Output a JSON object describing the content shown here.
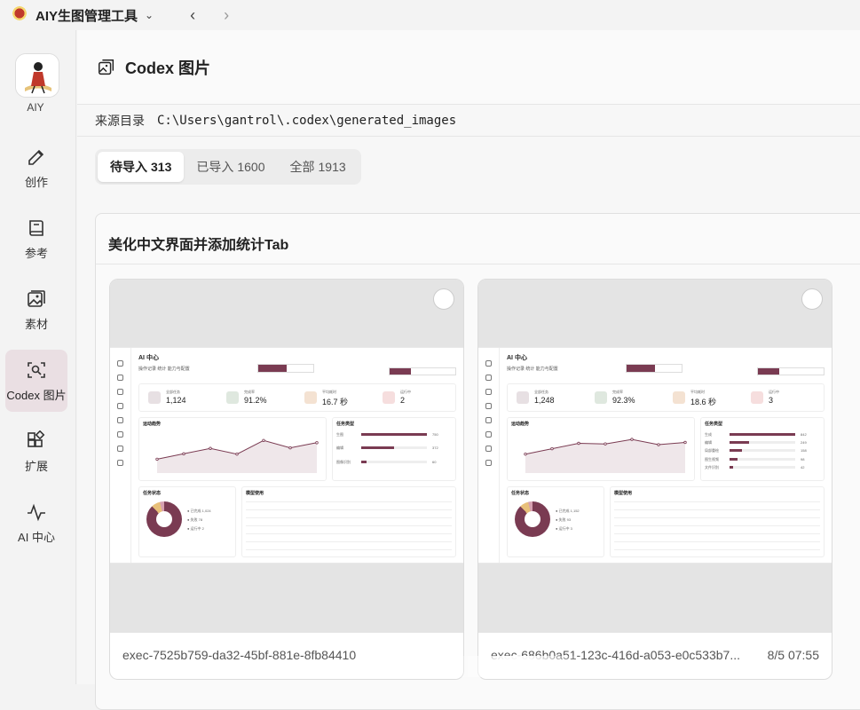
{
  "app": {
    "title": "AIY生图管理工具"
  },
  "sidebar": {
    "avatar_label": "AIY",
    "items": [
      {
        "label": "创作",
        "icon": "pen-icon"
      },
      {
        "label": "参考",
        "icon": "book-icon"
      },
      {
        "label": "素材",
        "icon": "image-icon"
      },
      {
        "label": "Codex 图片",
        "icon": "scan-icon",
        "active": true
      },
      {
        "label": "扩展",
        "icon": "grid-plus-icon"
      },
      {
        "label": "AI 中心",
        "icon": "pulse-icon"
      }
    ]
  },
  "page": {
    "title": "Codex 图片",
    "source_label": "来源目录",
    "source_path": "C:\\Users\\gantrol\\.codex\\generated_images"
  },
  "tabs": [
    {
      "label": "待导入",
      "count": "313",
      "active": true
    },
    {
      "label": "已导入",
      "count": "1600"
    },
    {
      "label": "全部",
      "count": "1913"
    }
  ],
  "group": {
    "title": "美化中文界面并添加统计Tab"
  },
  "cards": [
    {
      "file": "exec-7525b759-da32-45bf-881e-8fb84410",
      "time": "",
      "shot": {
        "title": "AI 中心",
        "tabs": [
          "操作记录",
          "统计",
          "能力与配置"
        ],
        "stats": [
          {
            "label": "全部任务",
            "value": "1,124"
          },
          {
            "label": "完成率",
            "value": "91.2%"
          },
          {
            "label": "平均耗时",
            "value": "16.7 秒"
          },
          {
            "label": "运行中",
            "value": "2"
          }
        ],
        "trend_title": "运动趋势",
        "trend_points": [
          92,
          128,
          164,
          126,
          217,
          168,
          202
        ],
        "types_title": "任务类型",
        "types": [
          {
            "name": "生图",
            "value": 750
          },
          {
            "name": "编辑",
            "value": 372
          },
          {
            "name": "图像识别",
            "value": 60
          }
        ],
        "status_title": "任务状态",
        "status": [
          {
            "name": "已完成",
            "value": "1,024"
          },
          {
            "name": "失败",
            "value": "78"
          },
          {
            "name": "运行中",
            "value": "2"
          }
        ],
        "models_title": "模型使用"
      }
    },
    {
      "file": "exec-686b0a51-123c-416d-a053-e0c533b7...",
      "time": "8/5 07:55",
      "shot": {
        "title": "AI 中心",
        "tabs": [
          "操作记录",
          "统计",
          "能力与配置"
        ],
        "stats": [
          {
            "label": "全部任务",
            "value": "1,248"
          },
          {
            "label": "完成率",
            "value": "92.3%"
          },
          {
            "label": "平均耗时",
            "value": "18.6 秒"
          },
          {
            "label": "运行中",
            "value": "3"
          }
        ],
        "trend_title": "运动趋势",
        "trend_points": [
          126,
          162,
          198,
          194,
          224,
          189,
          204
        ],
        "types_title": "任务类型",
        "types": [
          {
            "name": "生成",
            "value": 842
          },
          {
            "name": "编辑",
            "value": 249
          },
          {
            "name": "局部重绘",
            "value": 158
          },
          {
            "name": "图生视频",
            "value": 98
          },
          {
            "name": "文件识别",
            "value": 42
          }
        ],
        "status_title": "任务状态",
        "status": [
          {
            "name": "已完成",
            "value": "1,152"
          },
          {
            "name": "失败",
            "value": "93"
          },
          {
            "name": "运行中",
            "value": "3"
          }
        ],
        "models_title": "模型使用"
      }
    }
  ],
  "colors": {
    "accent": "#7a3b52",
    "active_bg": "#eadfe3"
  }
}
